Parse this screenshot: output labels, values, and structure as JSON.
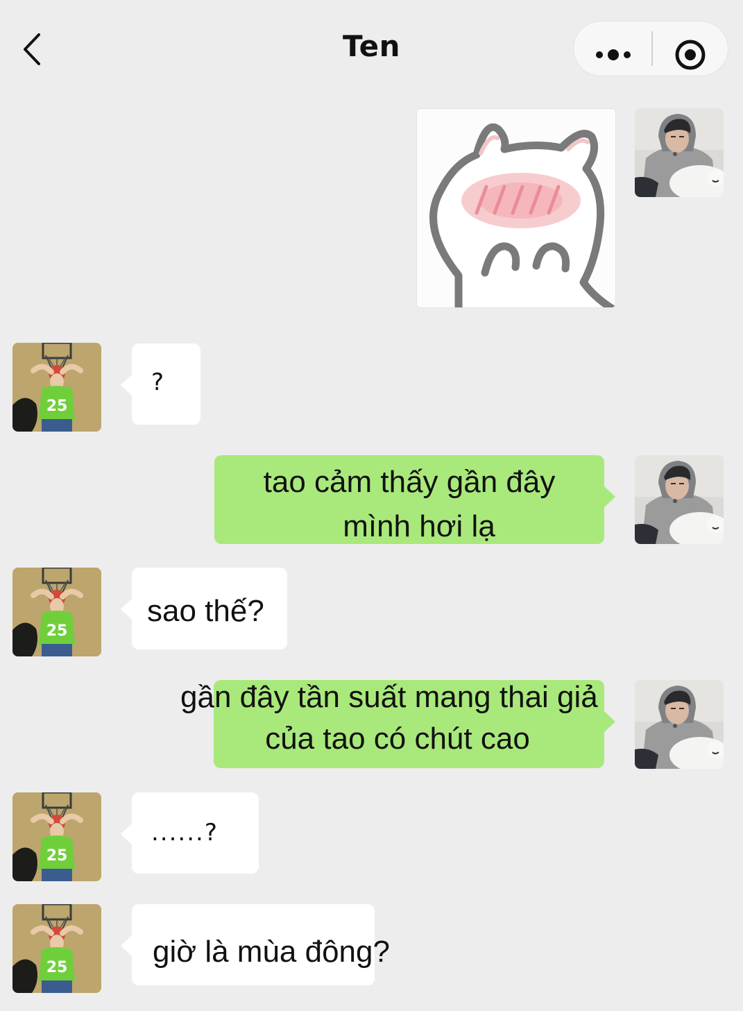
{
  "header": {
    "title": "Ten",
    "back_icon": "chevron-left-icon",
    "more_icon": "more-dots-icon",
    "close_icon": "target-close-icon"
  },
  "avatars": {
    "me": "avatar-hoodie-with-white-dog",
    "friend": "avatar-green-jersey-25"
  },
  "messages": [
    {
      "from": "me",
      "type": "sticker",
      "sticker": "blushing-cat-sticker"
    },
    {
      "from": "friend",
      "type": "text",
      "text": "?"
    },
    {
      "from": "me",
      "type": "text",
      "lines": [
        "tao cảm thấy gần đây",
        "mình hơi lạ"
      ]
    },
    {
      "from": "friend",
      "type": "text",
      "text": "sao thế?"
    },
    {
      "from": "me",
      "type": "text",
      "lines": [
        "gần đây tần suất mang thai giả",
        "của tao có chút cao"
      ]
    },
    {
      "from": "friend",
      "type": "text",
      "text": "......?"
    },
    {
      "from": "friend",
      "type": "text",
      "text": "giờ là mùa đông?"
    }
  ],
  "colors": {
    "background": "#ededed",
    "outgoing_bubble": "#a9e97b",
    "incoming_bubble": "#ffffff",
    "text": "#111111"
  }
}
